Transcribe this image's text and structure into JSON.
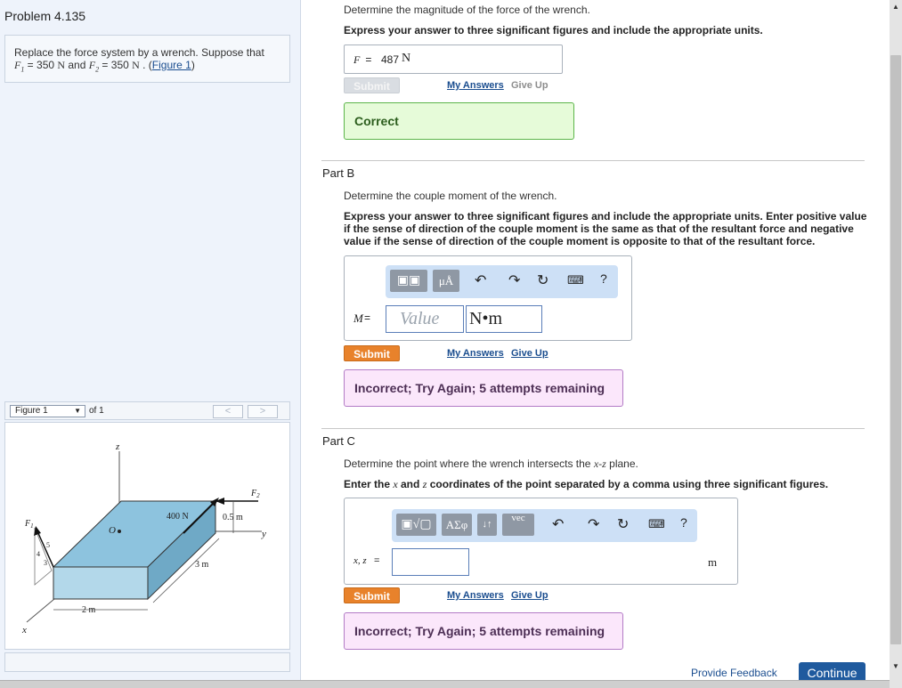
{
  "problem": {
    "title": "Problem 4.135",
    "statement_text": "Replace the force system by a wrench. Suppose that",
    "f1_sym": "F",
    "f1_sub": "1",
    "f1_value": " = 350 ",
    "f1_unit": "N",
    "and_text": " and ",
    "f2_sym": "F",
    "f2_sub": "2",
    "f2_value": " = 350 ",
    "f2_unit": "N",
    "period": " . (",
    "figure_link": "Figure 1",
    "close_paren": ")"
  },
  "figure_nav": {
    "select_value": "Figure 1",
    "of_text": "of 1",
    "prev": "<",
    "next": ">"
  },
  "figure": {
    "z_label": "z",
    "y_label": "y",
    "x_label": "x",
    "o_label": "O",
    "f1_label": "F",
    "f1_sub": "1",
    "f2_label": "F",
    "f2_sub": "2",
    "force_400": "400 N",
    "dim_05": "0.5 m",
    "dim_3": "3 m",
    "dim_2": "2 m",
    "ratio_5": "5",
    "ratio_4": "4",
    "ratio_3": "3"
  },
  "part_a": {
    "prompt": "Determine the magnitude of the force of the wrench.",
    "instructions": "Express your answer to three significant figures and include the appropriate units.",
    "answer_var": "F",
    "answer_eq": " =  ",
    "answer_value": "487",
    "answer_unit": "N",
    "submit": "Submit",
    "my_answers": "My Answers",
    "give_up": "Give Up",
    "feedback": "Correct"
  },
  "part_b": {
    "label": "Part B",
    "prompt": "Determine the couple moment of the wrench.",
    "instructions": "Express your answer to three significant figures and include the appropriate units. Enter positive value if the sense of direction of the couple moment is the same as that of the resultant force and negative value if the sense of direction of the couple moment is opposite to that of the resultant force.",
    "var_label": "M",
    "eq": " =",
    "value_placeholder": "Value",
    "unit_value": "N•m",
    "tb_units": "μÅ",
    "tb_help": "?",
    "submit": "Submit",
    "my_answers": "My Answers",
    "give_up": "Give Up",
    "feedback": "Incorrect; Try Again; 5 attempts remaining"
  },
  "part_c": {
    "label": "Part C",
    "prompt_pre": "Determine the point where the wrench intersects the ",
    "prompt_var": "x-z",
    "prompt_post": " plane.",
    "instr_pre": "Enter the ",
    "instr_x": "x",
    "instr_and": " and ",
    "instr_z": "z",
    "instr_post": " coordinates of the point separated by a comma using three significant figures.",
    "var_label": "x, z",
    "eq": " =",
    "unit": "m",
    "tb_greek": "ΑΣφ",
    "tb_arrows": "↓↑",
    "tb_vec": "vec",
    "tb_help": "?",
    "submit": "Submit",
    "my_answers": "My Answers",
    "give_up": "Give Up",
    "feedback": "Incorrect; Try Again; 5 attempts remaining"
  },
  "footer": {
    "provide_feedback": "Provide Feedback",
    "continue": "Continue"
  },
  "colors": {
    "correct_bg": "#e6fbd9",
    "incorrect_bg": "#fbe7fb",
    "submit_orange": "#e8822b",
    "continue_blue": "#1f5a9e",
    "box_fill": "#8dc3de"
  }
}
